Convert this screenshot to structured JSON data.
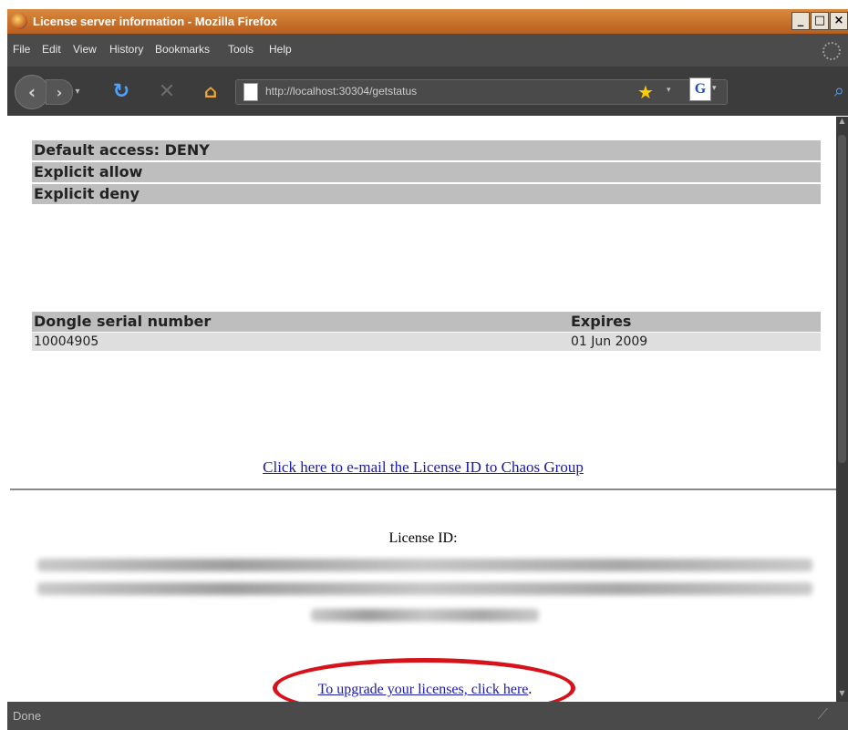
{
  "window": {
    "title": "License server information - Mozilla Firefox"
  },
  "menu": [
    "File",
    "Edit",
    "View",
    "History",
    "Bookmarks",
    "Tools",
    "Help"
  ],
  "nav": {
    "url": "http://localhost:30304/getstatus",
    "search_engine_letter": "G"
  },
  "access": {
    "default": "Default access: DENY",
    "allow": "Explicit allow",
    "deny": "Explicit deny"
  },
  "dongle_table": {
    "headers": [
      "Dongle serial number",
      "Expires"
    ],
    "rows": [
      [
        "10004905",
        "01 Jun 2009"
      ]
    ]
  },
  "email_link": "Click here to e-mail the License ID to Chaos Group",
  "license_id_label": "License ID:",
  "upgrade_link": "To upgrade your licenses, click here",
  "upgrade_suffix": ".",
  "status": "Done",
  "colors": {
    "annotation_ellipse": "#d6121a",
    "link": "#1a1aa8",
    "header_bg": "#bebebe"
  }
}
